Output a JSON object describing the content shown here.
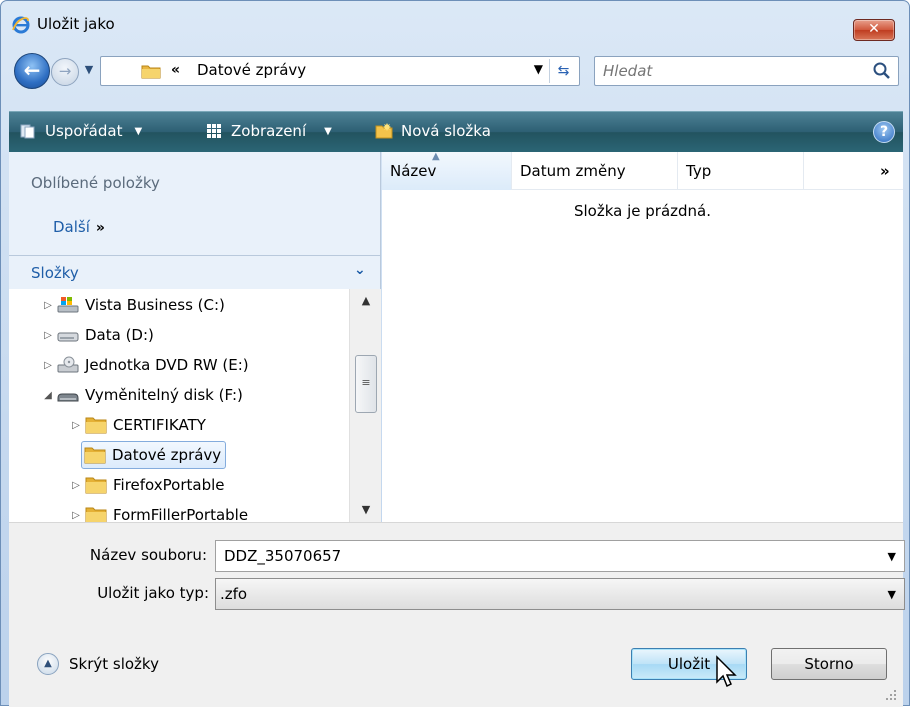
{
  "window": {
    "title": "Uložit jako"
  },
  "address": {
    "chevron": "«",
    "path": "Datové zprávy"
  },
  "search": {
    "placeholder": "Hledat"
  },
  "commandbar": {
    "organize": "Uspořádat",
    "views": "Zobrazení",
    "new_folder": "Nová složka"
  },
  "nav": {
    "favorites_header": "Oblíbené položky",
    "more": "Další",
    "more_chevron": "»",
    "folders_header": "Složky",
    "tree": [
      {
        "label": "Vista Business (C:)",
        "icon": "drive-windows-icon",
        "expander": "▷",
        "level": 1
      },
      {
        "label": "Data (D:)",
        "icon": "hard-drive-icon",
        "expander": "▷",
        "level": 1
      },
      {
        "label": "Jednotka DVD RW (E:)",
        "icon": "dvd-drive-icon",
        "expander": "▷",
        "level": 1
      },
      {
        "label": "Vyměnitelný disk (F:)",
        "icon": "removable-disk-icon",
        "expander": "◢",
        "level": 1
      },
      {
        "label": "CERTIFIKATY",
        "icon": "folder-icon",
        "expander": "▷",
        "level": 2
      },
      {
        "label": "Datové zprávy",
        "icon": "folder-icon",
        "expander": "",
        "level": 2,
        "selected": true
      },
      {
        "label": "FirefoxPortable",
        "icon": "folder-icon",
        "expander": "▷",
        "level": 2
      },
      {
        "label": "FormFillerPortable",
        "icon": "folder-icon",
        "expander": "▷",
        "level": 2
      }
    ]
  },
  "files": {
    "columns": [
      "Název",
      "Datum změny",
      "Typ"
    ],
    "more_columns": "»",
    "empty_message": "Složka je prázdná."
  },
  "form": {
    "filename_label": "Název souboru:",
    "filename_value": "DDZ_35070657",
    "filetype_label": "Uložit jako typ:",
    "filetype_value": ".zfo"
  },
  "footer": {
    "hide_folders": "Skrýt složky",
    "save": "Uložit",
    "cancel": "Storno"
  },
  "colors": {
    "commandbar": "#2d5f73",
    "link": "#1f5ea8",
    "close": "#c7432a"
  }
}
